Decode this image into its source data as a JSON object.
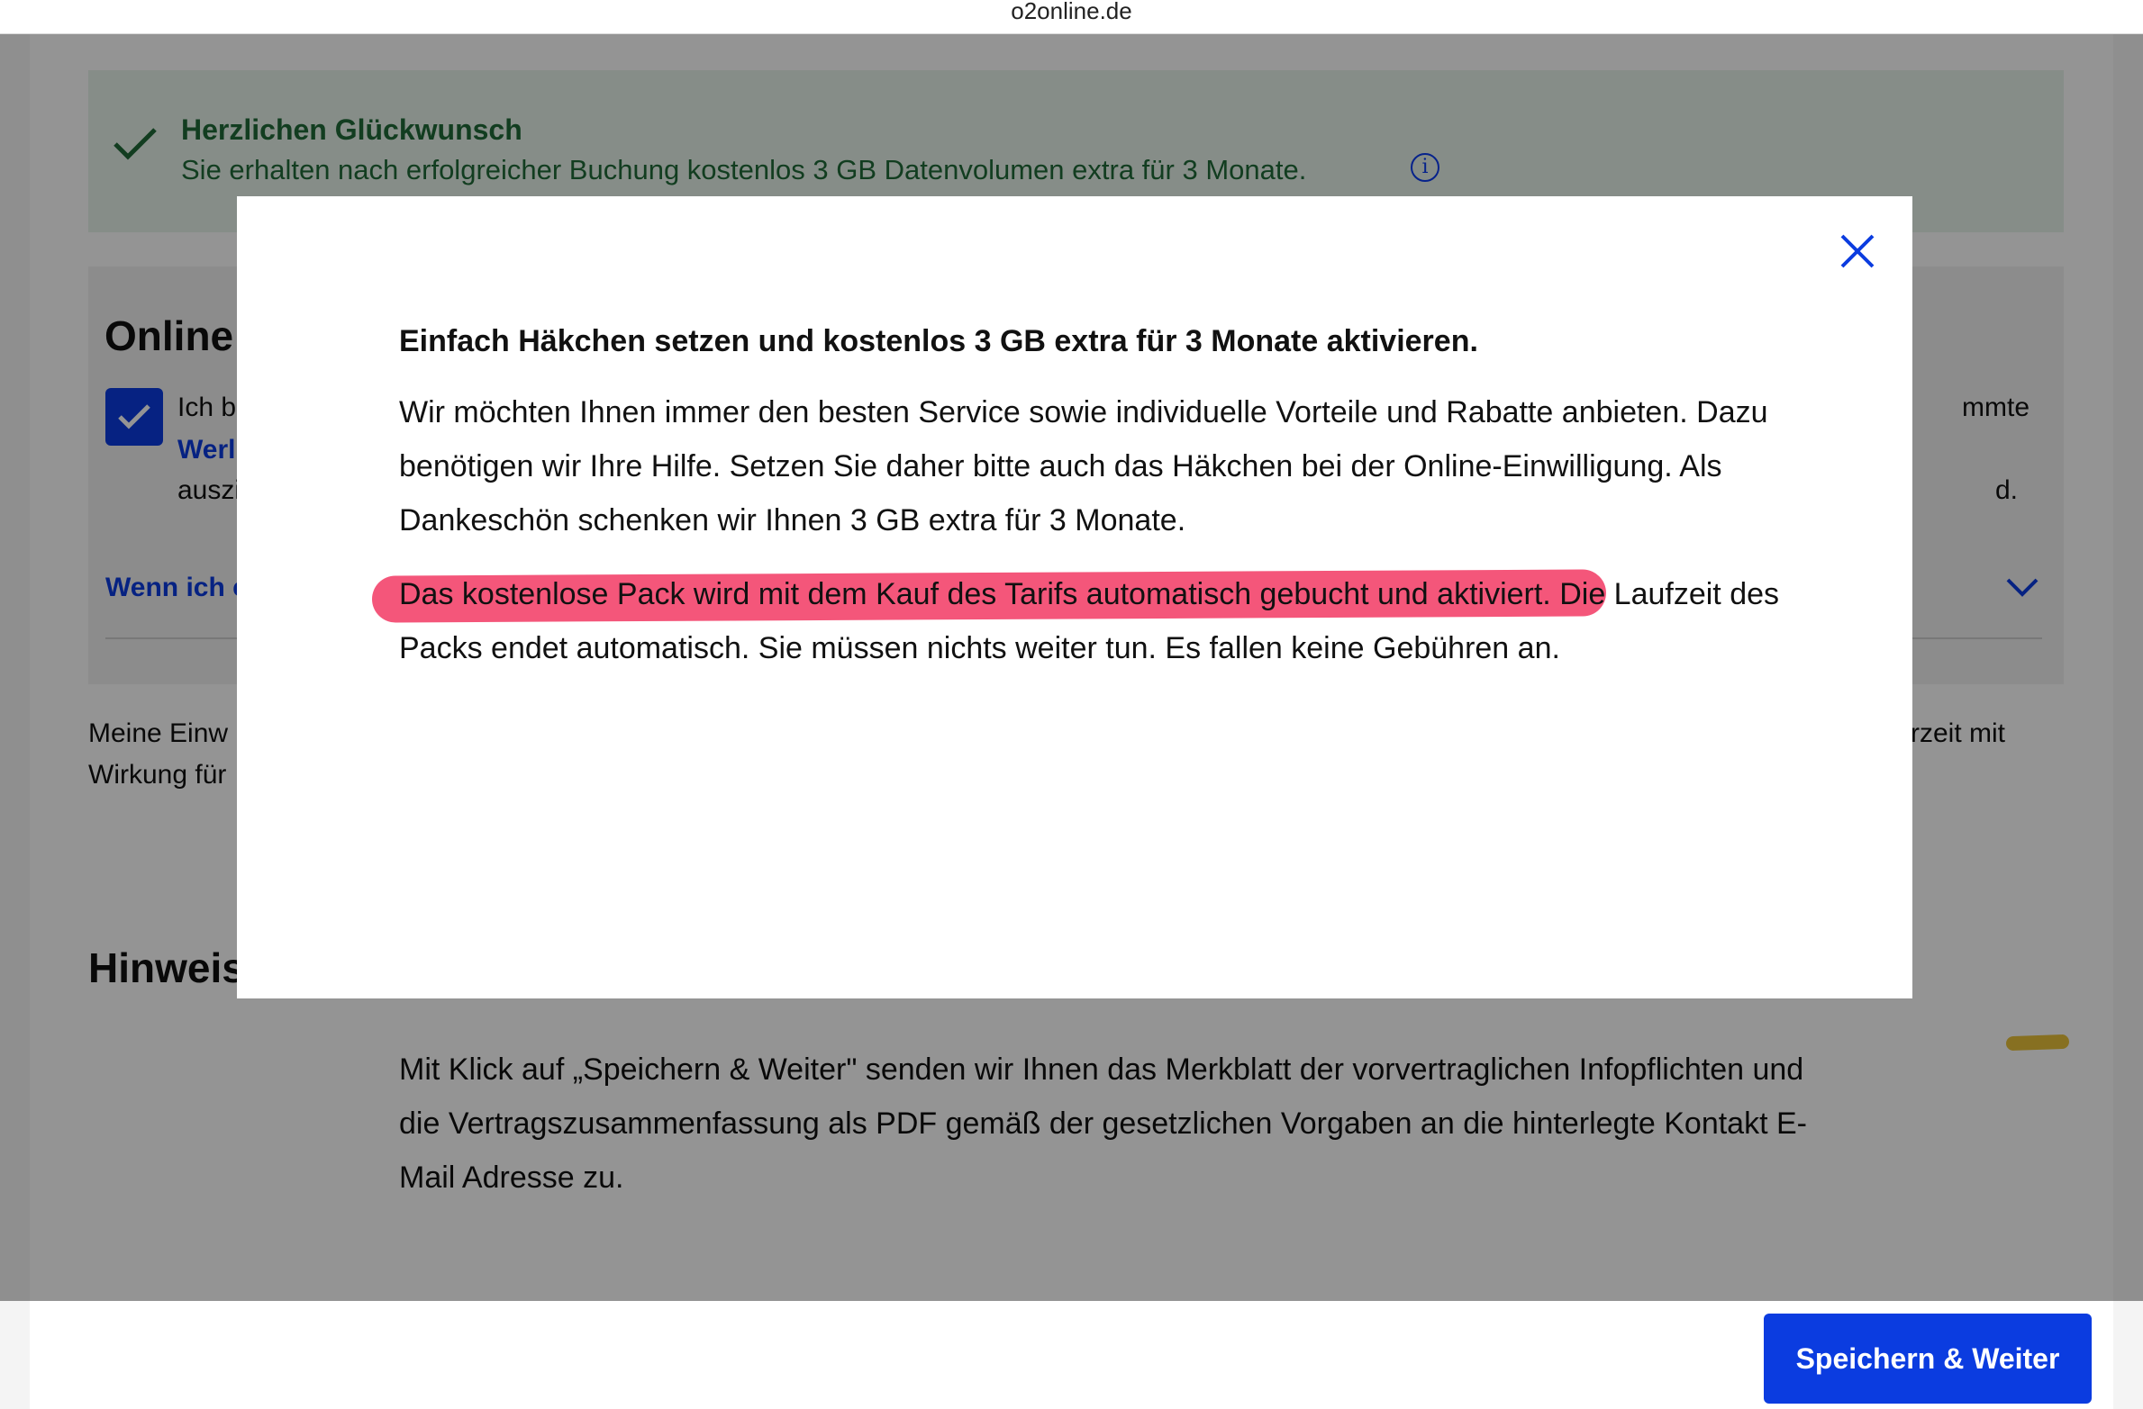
{
  "url": "o2online.de",
  "success": {
    "title": "Herzlichen Glückwunsch",
    "text": "Sie erhalten nach erfolgreicher Buchung kostenlos 3 GB Datenvolumen extra für 3 Monate.",
    "info_icon": "i"
  },
  "consent": {
    "title": "Online",
    "line1": "Ich b",
    "line2": "Werl",
    "line3": "auszi",
    "right1": "mmte",
    "right3": "d.",
    "link": "Wenn ich c"
  },
  "meine": {
    "line1": "Meine Einw",
    "line2": "Wirkung für",
    "right1": "rzeit mit"
  },
  "hinweis": {
    "title": "Hinweis",
    "text": "Mit Klick auf „Speichern & Weiter\" senden wir Ihnen das Merkblatt der vorvertraglichen Infopflichten und die Vertragszusammenfassung als PDF gemäß der gesetzlichen Vorgaben an die hinterlegte Kontakt E-Mail Adresse zu."
  },
  "footer": {
    "save_label": "Speichern & Weiter"
  },
  "modal": {
    "heading": "Einfach Häkchen setzen und kostenlos 3 GB extra für 3 Monate aktivieren.",
    "para1": "Wir möchten Ihnen immer den besten Service sowie individuelle Vorteile und Rabatte anbieten. Dazu benötigen wir Ihre Hilfe. Setzen Sie daher bitte auch das Häkchen bei der Online-Einwilligung. Als Dankeschön schenken wir Ihnen 3 GB extra für 3 Monate.",
    "para2_highlighted": "Das kostenlose Pack wird mit dem Kauf des Tarifs automatisch gebucht und aktiviert.",
    "para2_rest": " Die Laufzeit des Packs endet automatisch. Sie müssen nichts weiter tun. Es fallen keine Gebühren an."
  },
  "colors": {
    "accent": "#0b3ce0",
    "success_text": "#1f6a38",
    "highlight": "#f4567a"
  },
  "icons": [
    "check-icon",
    "info-icon",
    "checkbox-check-icon",
    "chevron-down-icon",
    "close-icon"
  ]
}
